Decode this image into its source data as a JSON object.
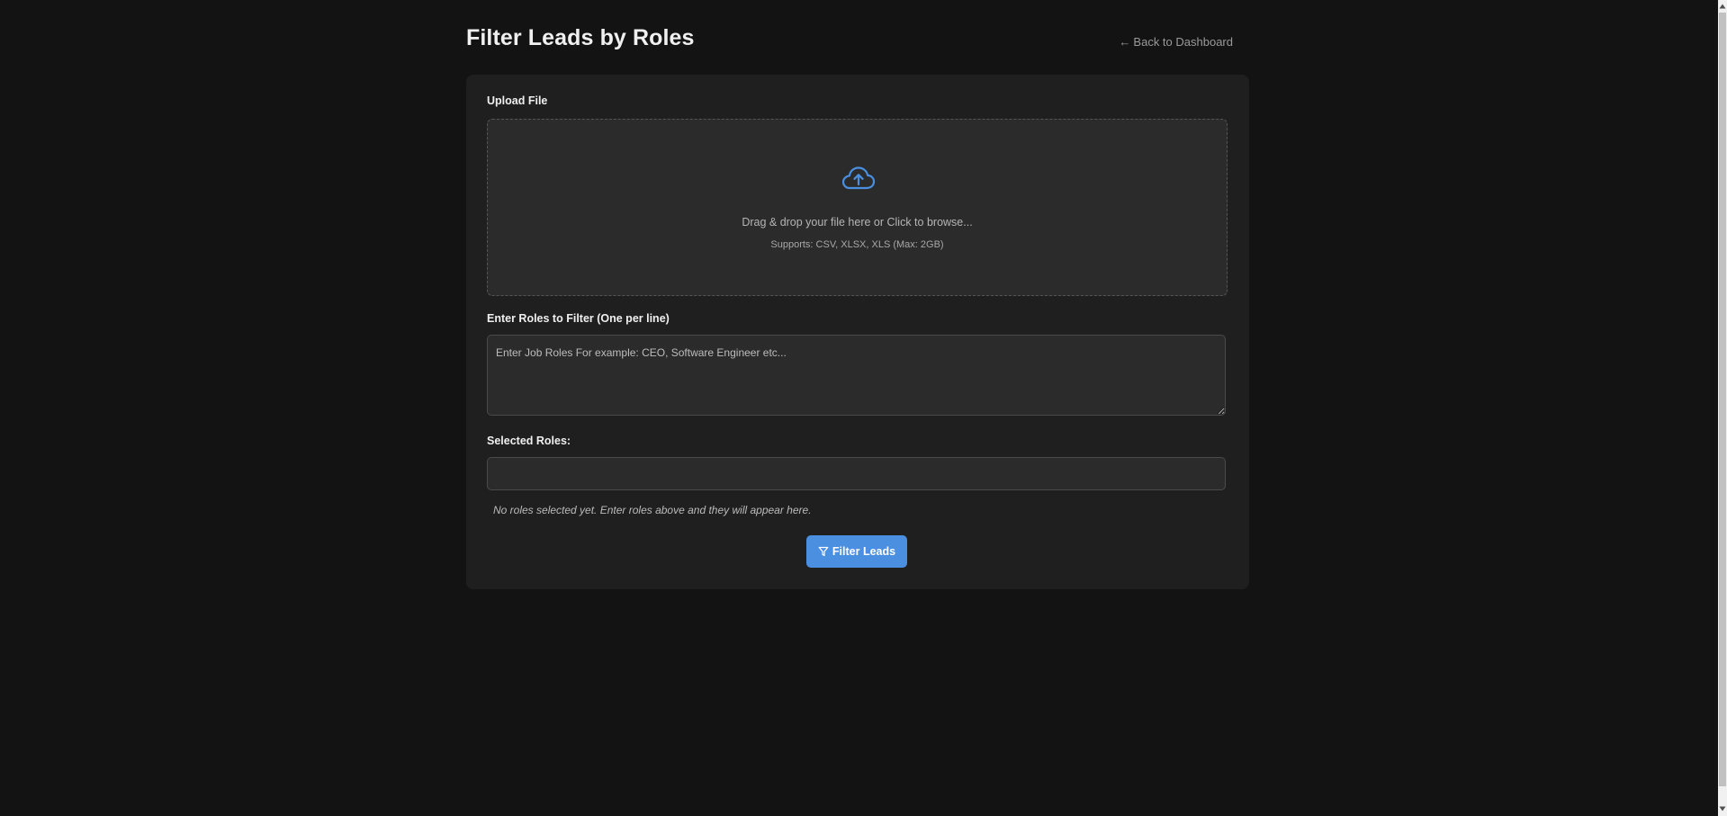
{
  "header": {
    "title": "Filter Leads by Roles",
    "back_link_arrow": "←",
    "back_link_label": "Back to Dashboard"
  },
  "upload": {
    "label": "Upload File",
    "drop_text": "Drag & drop your file here or Click to browse...",
    "supports_text": "Supports: CSV, XLSX, XLS (Max: 2GB)",
    "icon": "cloud-upload-icon"
  },
  "roles_input": {
    "label": "Enter Roles to Filter (One per line)",
    "value": "",
    "placeholder": "Enter Job Roles For example: CEO, Software Engineer etc..."
  },
  "selected_roles": {
    "label": "Selected Roles:",
    "empty_message": "No roles selected yet. Enter roles above and they will appear here."
  },
  "actions": {
    "filter_label": "Filter Leads",
    "filter_icon": "filter-icon"
  },
  "colors": {
    "background": "#131313",
    "card": "#1f1f1f",
    "accent": "#4a8fe0"
  }
}
